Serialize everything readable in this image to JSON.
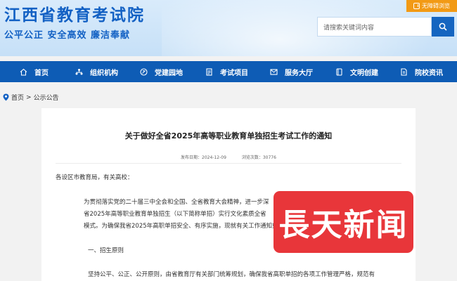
{
  "header": {
    "site_name": "江西省教育考试院",
    "slogan": "公平公正  安全高效  廉洁奉献",
    "accessibility_label": "无障碍浏览",
    "search_placeholder": "请搜索关键词内容"
  },
  "nav": {
    "items": [
      {
        "label": "首页",
        "icon": "home-icon"
      },
      {
        "label": "组织机构",
        "icon": "org-icon"
      },
      {
        "label": "党建园地",
        "icon": "party-icon"
      },
      {
        "label": "考试项目",
        "icon": "document-icon"
      },
      {
        "label": "服务大厅",
        "icon": "service-icon"
      },
      {
        "label": "文明创建",
        "icon": "book-icon"
      },
      {
        "label": "院校资讯",
        "icon": "file-icon"
      }
    ]
  },
  "breadcrumb": {
    "home": "首页",
    "separator": ">",
    "current": "公示公告"
  },
  "article": {
    "title": "关于做好全省2025年高等职业教育单独招生考试工作的通知",
    "publish_label": "发布日期：",
    "publish_date": "2024-12-09",
    "views_label": "浏览次数：",
    "views": "30776",
    "salutation": "各设区市教育局，有关高校：",
    "p1_line1": "为贯彻落实党的二十届三中全会和全国、全省教育大会精神，进一步深",
    "p1_line2": "省2025年高等职业教育单独招生（以下简称单招）实行文化素质全省",
    "p1_line3": "模式。为确保我省2025年高职单招安全、有序实施，现就有关工作通知如下",
    "section1": "一、招生原则",
    "p2_line1": "坚持公平、公正、公开原则，由省教育厅有关部门统筹规划，确保我省高职单招的各项工作管理严格，规范有"
  },
  "watermark": {
    "text": "長天新闻"
  },
  "colors": {
    "primary_blue": "#0e5cb5",
    "title_blue": "#1361c4",
    "accent_orange": "#f29a15",
    "logo_red": "#e8363a"
  }
}
